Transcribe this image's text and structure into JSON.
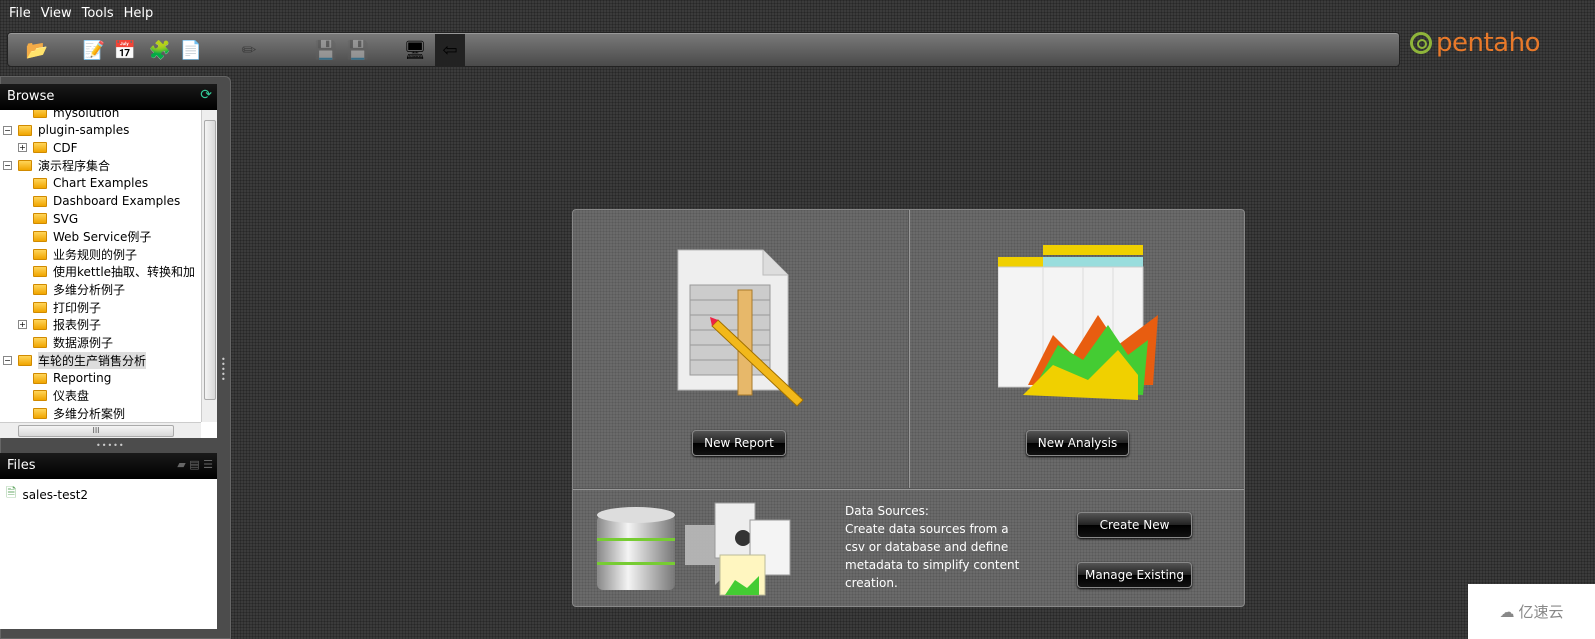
{
  "menu": [
    "File",
    "View",
    "Tools",
    "Help"
  ],
  "toolbar": {
    "icons": [
      "open-folder-icon",
      "new-report-icon",
      "new-analysis-icon",
      "plugin-install-icon",
      "pdf-report-icon",
      "edit-pencil-icon",
      "save-icon",
      "save-as-icon",
      "monitor-icon",
      "toggle-browser-icon"
    ]
  },
  "logo": {
    "text": "pentaho",
    "color": "#e8792a",
    "swirl_color": "#8fb53a"
  },
  "browse": {
    "title": "Browse",
    "tree": [
      {
        "label": "mysolution",
        "level": 1,
        "exp": ""
      },
      {
        "label": "plugin-samples",
        "level": 0,
        "exp": "minus"
      },
      {
        "label": "CDF",
        "level": 1,
        "exp": "plus"
      },
      {
        "label": "演示程序集合",
        "level": 0,
        "exp": "minus"
      },
      {
        "label": "Chart Examples",
        "level": 1,
        "exp": ""
      },
      {
        "label": "Dashboard Examples",
        "level": 1,
        "exp": ""
      },
      {
        "label": "SVG",
        "level": 1,
        "exp": ""
      },
      {
        "label": "Web Service例子",
        "level": 1,
        "exp": ""
      },
      {
        "label": "业务规则的例子",
        "level": 1,
        "exp": ""
      },
      {
        "label": "使用kettle抽取、转换和加",
        "level": 1,
        "exp": ""
      },
      {
        "label": "多维分析例子",
        "level": 1,
        "exp": ""
      },
      {
        "label": "打印例子",
        "level": 1,
        "exp": ""
      },
      {
        "label": "报表例子",
        "level": 1,
        "exp": "plus"
      },
      {
        "label": "数据源例子",
        "level": 1,
        "exp": ""
      },
      {
        "label": "车轮的生产销售分析",
        "level": 0,
        "exp": "minus",
        "selected": true
      },
      {
        "label": "Reporting",
        "level": 1,
        "exp": ""
      },
      {
        "label": "仪表盘",
        "level": 1,
        "exp": ""
      },
      {
        "label": "多维分析案例",
        "level": 1,
        "exp": ""
      }
    ]
  },
  "files": {
    "title": "Files",
    "items": [
      "sales-test2"
    ]
  },
  "main": {
    "new_report": "New Report",
    "new_analysis": "New Analysis",
    "data_sources_title": "Data Sources:",
    "data_sources_desc": "Create data sources from a csv or database and define metadata to simplify content creation.",
    "create_new": "Create New",
    "manage_existing": "Manage Existing"
  },
  "watermark": "亿速云"
}
